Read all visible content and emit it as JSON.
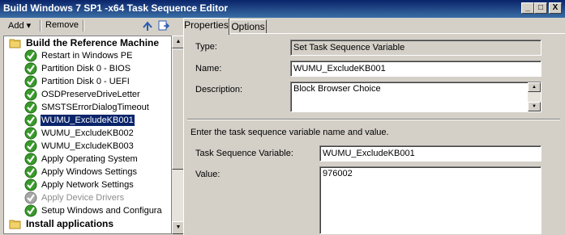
{
  "window": {
    "title": "Build Windows 7 SP1 -x64 Task Sequence Editor",
    "minimize_glyph": "_",
    "maximize_glyph": "□",
    "close_glyph": "X"
  },
  "toolbar": {
    "add_label": "Add",
    "add_arrow": "▾",
    "remove_label": "Remove"
  },
  "tree": {
    "items": [
      {
        "label": "Build the Reference Machine",
        "icon": "folder-icon",
        "bold": true,
        "state": "normal"
      },
      {
        "label": "Restart in Windows PE",
        "icon": "green-check-icon",
        "state": "normal"
      },
      {
        "label": "Partition Disk 0 - BIOS",
        "icon": "green-check-icon",
        "state": "normal"
      },
      {
        "label": "Partition Disk 0 - UEFI",
        "icon": "green-check-icon",
        "state": "normal"
      },
      {
        "label": "OSDPreserveDriveLetter",
        "icon": "green-check-icon",
        "state": "normal"
      },
      {
        "label": "SMSTSErrorDialogTimeout",
        "icon": "green-check-icon",
        "state": "normal"
      },
      {
        "label": "WUMU_ExcludeKB001",
        "icon": "green-check-icon",
        "state": "selected"
      },
      {
        "label": "WUMU_ExcludeKB002",
        "icon": "green-check-icon",
        "state": "normal"
      },
      {
        "label": "WUMU_ExcludeKB003",
        "icon": "green-check-icon",
        "state": "normal"
      },
      {
        "label": "Apply Operating System",
        "icon": "green-check-icon",
        "state": "normal"
      },
      {
        "label": "Apply Windows Settings",
        "icon": "green-check-icon",
        "state": "normal"
      },
      {
        "label": "Apply Network Settings",
        "icon": "green-check-icon",
        "state": "normal"
      },
      {
        "label": "Apply Device Drivers",
        "icon": "gray-check-icon",
        "state": "disabled"
      },
      {
        "label": "Setup Windows and Configura",
        "icon": "green-check-icon",
        "state": "normal"
      },
      {
        "label": "Install applications",
        "icon": "folder-icon",
        "bold": true,
        "state": "normal"
      }
    ]
  },
  "scroll": {
    "up": "▲",
    "down": "▼"
  },
  "tabs": [
    {
      "label": "Properties",
      "active": true
    },
    {
      "label": "Options",
      "active": false
    }
  ],
  "properties": {
    "type_label": "Type:",
    "type_value": "Set Task Sequence Variable",
    "name_label": "Name:",
    "name_value": "WUMU_ExcludeKB001",
    "description_label": "Description:",
    "description_value": "Block Browser Choice",
    "instructions": "Enter the task sequence variable name and value.",
    "variable_label": "Task Sequence Variable:",
    "variable_value": "WUMU_ExcludeKB001",
    "value_label": "Value:",
    "value_value": "976002"
  },
  "colors": {
    "selection": "#0a246a",
    "check_green": "#3a9a2c",
    "disabled_text": "#8c8c8c"
  }
}
